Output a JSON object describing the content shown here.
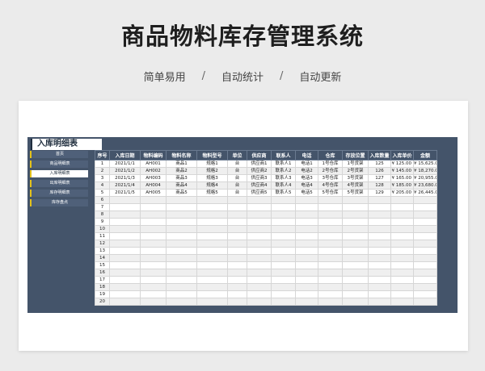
{
  "header": {
    "title": "商品物料库存管理系统",
    "tags": [
      "简单易用",
      "自动统计",
      "自动更新"
    ],
    "separator": "/"
  },
  "sheet": {
    "title": "入库明细表",
    "nav": [
      {
        "label": "首页",
        "active": false
      },
      {
        "label": "商品明细表",
        "active": false
      },
      {
        "label": "入库明细表",
        "active": true
      },
      {
        "label": "出库明细表",
        "active": false
      },
      {
        "label": "库存明细表",
        "active": false
      },
      {
        "label": "库存盘点",
        "active": false
      }
    ],
    "columns": [
      "序号",
      "入库日期",
      "物料编码",
      "物料名称",
      "物料型号",
      "单位",
      "供应商",
      "联系人",
      "电话",
      "仓库",
      "存放位置",
      "入库数量",
      "入库单价",
      "金额"
    ],
    "rows": [
      [
        "1",
        "2021/1/1",
        "AH001",
        "商品1",
        "规格1",
        "台",
        "供应商1",
        "联系人1",
        "电话1",
        "1号仓库",
        "1号货架",
        "125",
        "¥ 125.00",
        "¥ 15,625.00"
      ],
      [
        "2",
        "2021/1/2",
        "AH002",
        "商品2",
        "规格2",
        "台",
        "供应商2",
        "联系人2",
        "电话2",
        "2号仓库",
        "2号货架",
        "126",
        "¥ 145.00",
        "¥ 18,270.00"
      ],
      [
        "3",
        "2021/1/3",
        "AH003",
        "商品3",
        "规格3",
        "台",
        "供应商3",
        "联系人3",
        "电话3",
        "3号仓库",
        "3号货架",
        "127",
        "¥ 165.00",
        "¥ 20,955.00"
      ],
      [
        "4",
        "2021/1/4",
        "AH004",
        "商品4",
        "规格4",
        "台",
        "供应商4",
        "联系人4",
        "电话4",
        "4号仓库",
        "4号货架",
        "128",
        "¥ 185.00",
        "¥ 23,680.00"
      ],
      [
        "5",
        "2021/1/5",
        "AH005",
        "商品5",
        "规格5",
        "台",
        "供应商5",
        "联系人5",
        "电话5",
        "5号仓库",
        "5号货架",
        "129",
        "¥ 205.00",
        "¥ 26,445.00"
      ],
      [
        "6"
      ],
      [
        "7"
      ],
      [
        "8"
      ],
      [
        "9"
      ],
      [
        "10"
      ],
      [
        "11"
      ],
      [
        "12"
      ],
      [
        "13"
      ],
      [
        "14"
      ],
      [
        "15"
      ],
      [
        "16"
      ],
      [
        "17"
      ],
      [
        "18"
      ],
      [
        "19"
      ],
      [
        "20"
      ]
    ]
  },
  "colors": {
    "background": "#ebebeb",
    "sheet": "#44546a",
    "nav_accent": "#e4c21a"
  }
}
